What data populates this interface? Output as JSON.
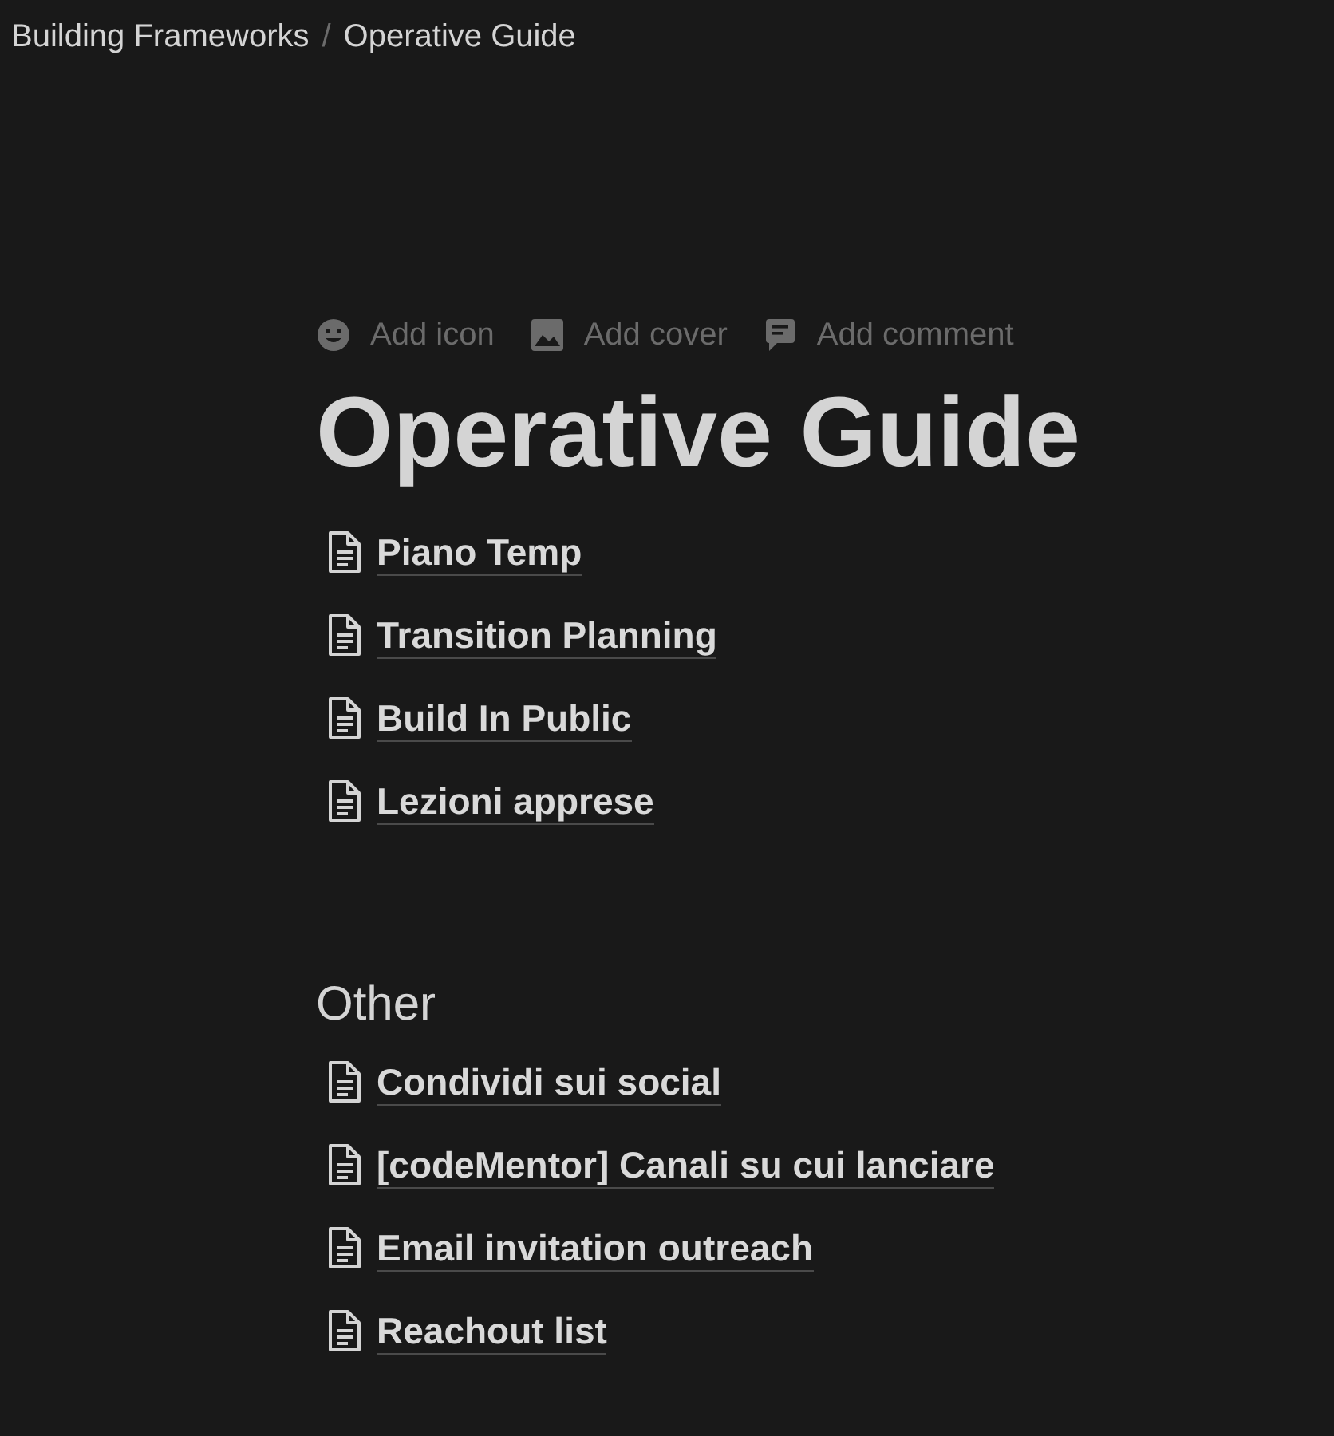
{
  "breadcrumb": [
    {
      "label": "Building Frameworks"
    },
    {
      "label": "Operative Guide"
    }
  ],
  "separator": "/",
  "page_actions": [
    {
      "kind": "icon",
      "label": "Add icon"
    },
    {
      "kind": "cover",
      "label": "Add cover"
    },
    {
      "kind": "comment",
      "label": "Add comment"
    }
  ],
  "title": "Operative Guide",
  "links": [
    {
      "label": "Piano Temp"
    },
    {
      "label": "Transition Planning"
    },
    {
      "label": "Build In Public"
    },
    {
      "label": "Lezioni apprese"
    }
  ],
  "section": {
    "heading": "Other",
    "links": [
      {
        "label": "Condividi sui social"
      },
      {
        "label": "[codeMentor] Canali su cui lanciare"
      },
      {
        "label": "Email invitation outreach"
      },
      {
        "label": "Reachout list"
      }
    ]
  }
}
